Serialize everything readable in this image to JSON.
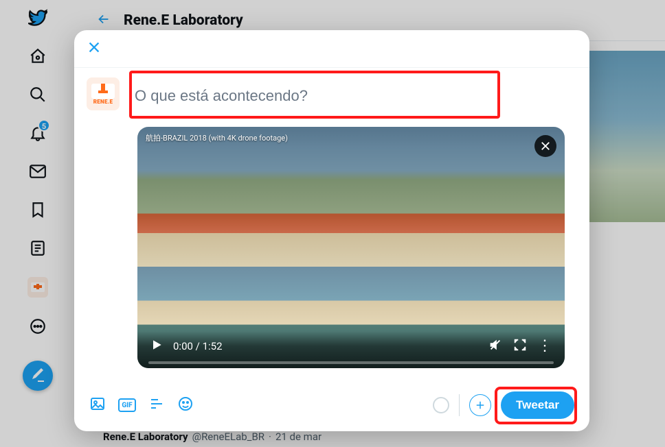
{
  "sidebar": {
    "notification_badge": "5"
  },
  "header": {
    "title": "Rene.E Laboratory"
  },
  "feed": {
    "name": "Rene.E Laboratory",
    "handle": "@ReneELab_BR",
    "sep": "·",
    "date": "21 de mar"
  },
  "avatar_text": "RENE.E",
  "compose": {
    "placeholder": "O que está acontecendo?",
    "value": ""
  },
  "video": {
    "title": "航拍-BRAZIL 2018 (with 4K drone footage)",
    "current": "0:00",
    "sep": "/",
    "duration": "1:52"
  },
  "gif_label": "GIF",
  "tweet_button": "Tweetar"
}
